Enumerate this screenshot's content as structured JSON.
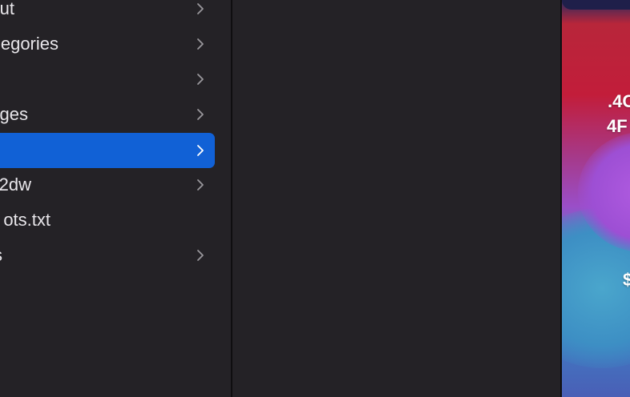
{
  "finder": {
    "items": [
      {
        "label": "ut",
        "has_chevron": true
      },
      {
        "label": "egories",
        "has_chevron": true
      },
      {
        "label": "",
        "has_chevron": true
      },
      {
        "label": "ges",
        "has_chevron": true
      },
      {
        "label": "",
        "has_chevron": true,
        "selected": true
      },
      {
        "label": "2dw",
        "has_chevron": true
      },
      {
        "label": "ots.txt",
        "has_chevron": false
      },
      {
        "label": "s",
        "has_chevron": true
      }
    ]
  },
  "wallpaper": {
    "text_lines": [
      ".4C",
      "4F",
      "$"
    ]
  },
  "colors": {
    "background": "#242226",
    "selection": "#1161d6",
    "text": "#e8e6ea",
    "chevron": "#9a989c"
  },
  "icons": {
    "chevron": "chevron-right-icon"
  }
}
